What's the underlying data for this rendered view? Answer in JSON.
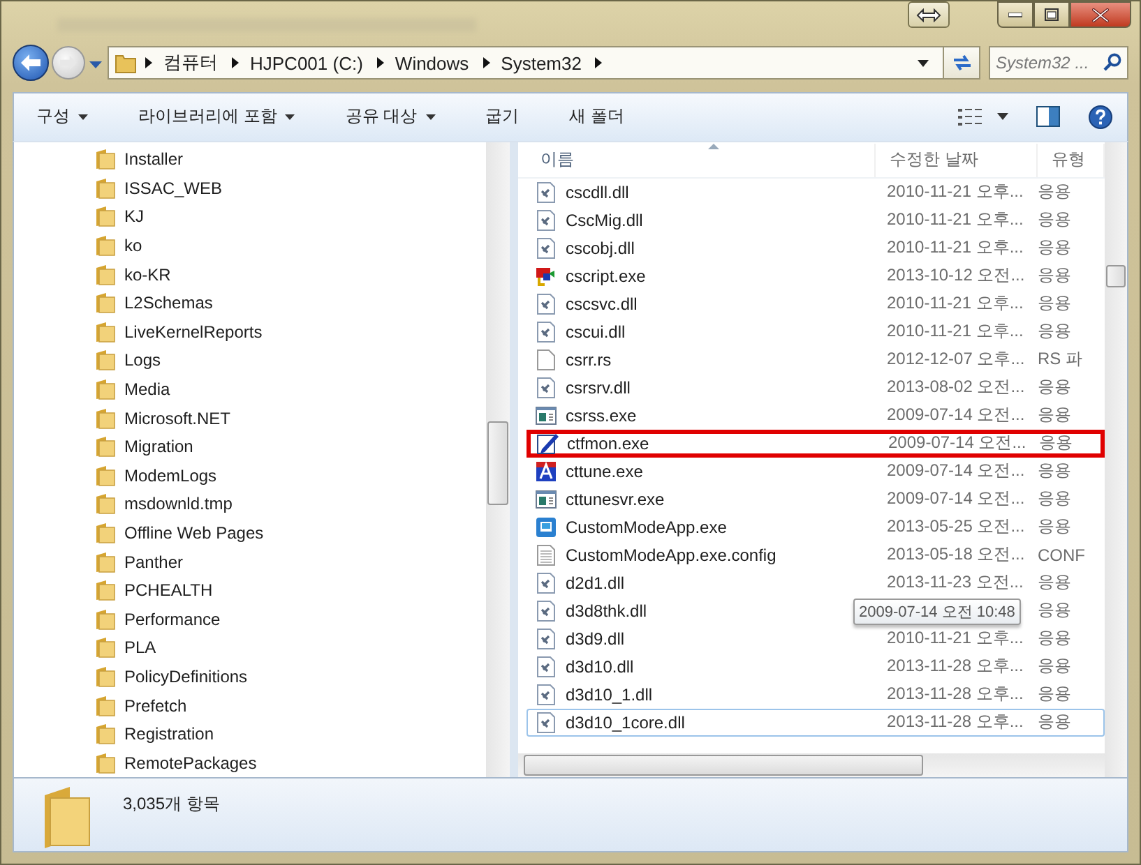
{
  "address": {
    "crumbs": [
      "컴퓨터",
      "HJPC001 (C:)",
      "Windows",
      "System32"
    ],
    "search_placeholder": "System32 ..."
  },
  "toolbar": {
    "items": [
      {
        "label": "구성",
        "menu": true
      },
      {
        "label": "라이브러리에 포함",
        "menu": true
      },
      {
        "label": "공유 대상",
        "menu": true
      },
      {
        "label": "굽기",
        "menu": false
      },
      {
        "label": "새 폴더",
        "menu": false
      }
    ]
  },
  "nav": {
    "items": [
      "Installer",
      "ISSAC_WEB",
      "KJ",
      "ko",
      "ko-KR",
      "L2Schemas",
      "LiveKernelReports",
      "Logs",
      "Media",
      "Microsoft.NET",
      "Migration",
      "ModemLogs",
      "msdownld.tmp",
      "Offline Web Pages",
      "Panther",
      "PCHEALTH",
      "Performance",
      "PLA",
      "PolicyDefinitions",
      "Prefetch",
      "Registration",
      "RemotePackages"
    ]
  },
  "files": {
    "columns": [
      "이름",
      "수정한 날짜",
      "유형"
    ],
    "rows": [
      {
        "name": "cscdll.dll",
        "date": "2010-11-21 오후...",
        "type": "응용",
        "kind": "dll",
        "annotated": false,
        "focused": false
      },
      {
        "name": "CscMig.dll",
        "date": "2010-11-21 오후...",
        "type": "응용",
        "kind": "dll",
        "annotated": false,
        "focused": false
      },
      {
        "name": "cscobj.dll",
        "date": "2010-11-21 오후...",
        "type": "응용",
        "kind": "dll",
        "annotated": false,
        "focused": false
      },
      {
        "name": "cscript.exe",
        "date": "2013-10-12 오전...",
        "type": "응용",
        "kind": "script",
        "annotated": false,
        "focused": false
      },
      {
        "name": "cscsvc.dll",
        "date": "2010-11-21 오후...",
        "type": "응용",
        "kind": "dll",
        "annotated": false,
        "focused": false
      },
      {
        "name": "cscui.dll",
        "date": "2010-11-21 오후...",
        "type": "응용",
        "kind": "dll",
        "annotated": false,
        "focused": false
      },
      {
        "name": "csrr.rs",
        "date": "2012-12-07 오후...",
        "type": "RS 파",
        "kind": "file",
        "annotated": false,
        "focused": false
      },
      {
        "name": "csrsrv.dll",
        "date": "2013-08-02 오전...",
        "type": "응용",
        "kind": "dll",
        "annotated": false,
        "focused": false
      },
      {
        "name": "csrss.exe",
        "date": "2009-07-14 오전...",
        "type": "응용",
        "kind": "window",
        "annotated": false,
        "focused": false
      },
      {
        "name": "ctfmon.exe",
        "date": "2009-07-14 오전...",
        "type": "응용",
        "kind": "pen",
        "annotated": true,
        "focused": false
      },
      {
        "name": "cttune.exe",
        "date": "2009-07-14 오전...",
        "type": "응용",
        "kind": "font",
        "annotated": false,
        "focused": false
      },
      {
        "name": "cttunesvr.exe",
        "date": "2009-07-14 오전...",
        "type": "응용",
        "kind": "window",
        "annotated": false,
        "focused": false
      },
      {
        "name": "CustomModeApp.exe",
        "date": "2013-05-25 오전...",
        "type": "응용",
        "kind": "app",
        "annotated": false,
        "focused": false
      },
      {
        "name": "CustomModeApp.exe.config",
        "date": "2013-05-18 오전...",
        "type": "CONF",
        "kind": "text",
        "annotated": false,
        "focused": false
      },
      {
        "name": "d2d1.dll",
        "date": "2013-11-23 오전...",
        "type": "응용",
        "kind": "dll",
        "annotated": false,
        "focused": false
      },
      {
        "name": "d3d8thk.dll",
        "type": "응용",
        "kind": "dll",
        "annotated": false,
        "focused": false,
        "tooltip": "2009-07-14 오전 10:48"
      },
      {
        "name": "d3d9.dll",
        "date": "2010-11-21 오후...",
        "type": "응용",
        "kind": "dll",
        "annotated": false,
        "focused": false
      },
      {
        "name": "d3d10.dll",
        "date": "2013-11-28 오후...",
        "type": "응용",
        "kind": "dll",
        "annotated": false,
        "focused": false
      },
      {
        "name": "d3d10_1.dll",
        "date": "2013-11-28 오후...",
        "type": "응용",
        "kind": "dll",
        "annotated": false,
        "focused": false
      },
      {
        "name": "d3d10_1core.dll",
        "date": "2013-11-28 오후...",
        "type": "응용",
        "kind": "dll",
        "annotated": false,
        "focused": true
      }
    ]
  },
  "status_bar": {
    "count": "3,035개 항목"
  }
}
